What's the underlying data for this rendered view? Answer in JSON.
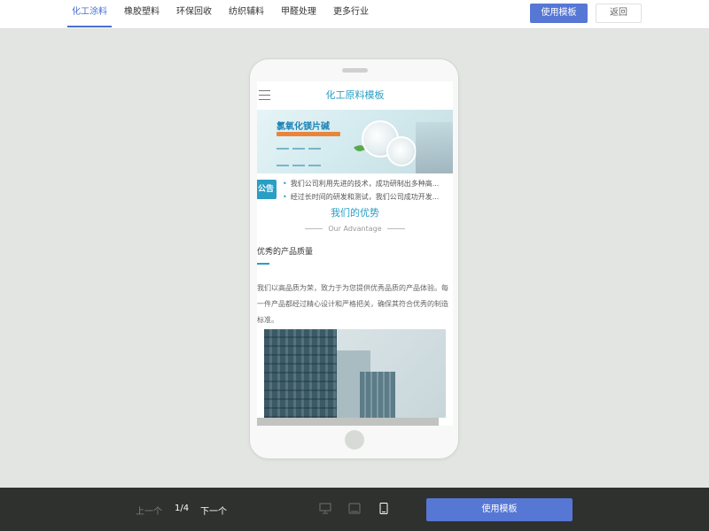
{
  "nav": {
    "tabs": [
      {
        "label": "化工涂料",
        "active": true
      },
      {
        "label": "橡胶塑料",
        "active": false
      },
      {
        "label": "环保回收",
        "active": false
      },
      {
        "label": "纺织辅料",
        "active": false
      },
      {
        "label": "甲醛处理",
        "active": false
      },
      {
        "label": "更多行业",
        "active": false
      }
    ],
    "use_template_label": "使用模板",
    "back_label": "返回"
  },
  "preview": {
    "title": "化工原料模板",
    "banner_title": "氯氧化镁片碱",
    "notice_badge": "公告",
    "notices": [
      "我们公司利用先进的技术，成功研制出多种高...",
      "经过长时间的研发和测试，我们公司成功开发..."
    ],
    "advantage_title": "我们的优势",
    "advantage_sub": "Our Advantage",
    "quality_title": "优秀的产品质量",
    "quality_desc": "我们以高品质为荣，致力于为您提供优秀品质的产品体验。每一件产品都经过精心设计和严格把关，确保其符合优秀的制造标准。"
  },
  "footer": {
    "prev_label": "上一个",
    "page_indicator": "1/4",
    "next_label": "下一个",
    "use_template_label": "使用模板",
    "devices": [
      "desktop-icon",
      "tablet-icon",
      "mobile-icon"
    ]
  },
  "colors": {
    "accent": "#5777d5",
    "brand": "#2a9ec4",
    "footer_bg": "#2e312e"
  }
}
